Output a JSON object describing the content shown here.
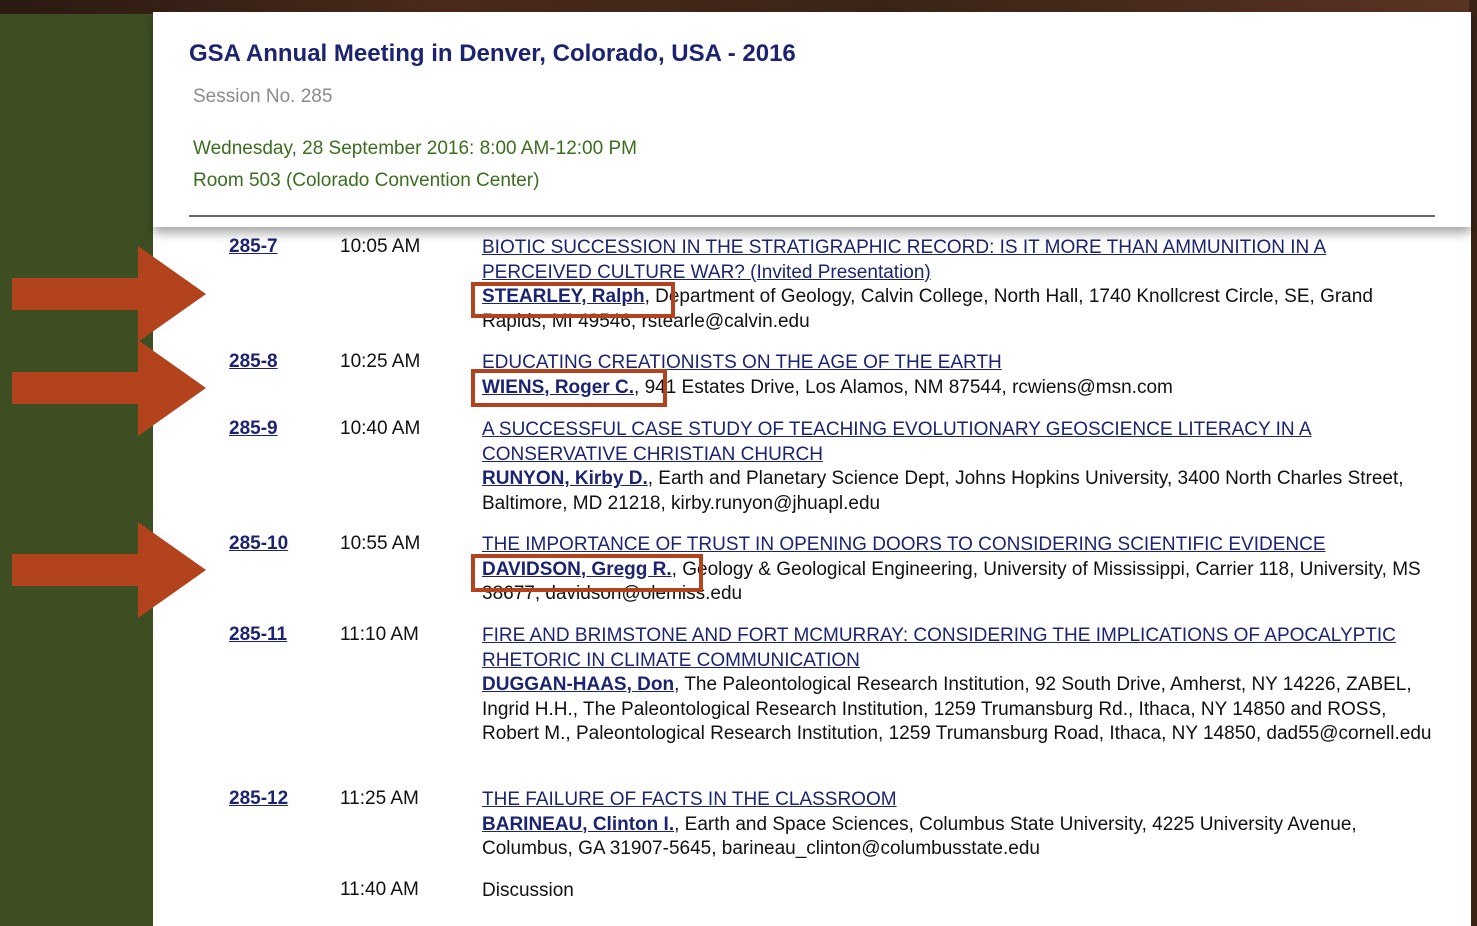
{
  "header": {
    "title": "GSA Annual Meeting in Denver, Colorado, USA - 2016",
    "session_no": "Session No. 285",
    "date_time": "Wednesday, 28 September 2016: 8:00 AM-12:00 PM",
    "room": "Room 503 (Colorado Convention Center)"
  },
  "talks": [
    {
      "code": "285-7",
      "time": "10:05 AM",
      "title": "BIOTIC SUCCESSION IN THE STRATIGRAPHIC RECORD: IS IT MORE THAN AMMUNITION IN A PERCEIVED CULTURE WAR? (Invited Presentation)",
      "author": "STEARLEY, Ralph",
      "affiliation": ", Department of Geology, Calvin College, North Hall, 1740 Knollcrest Circle, SE, Grand Rapids, MI 49546, rstearle@calvin.edu"
    },
    {
      "code": "285-8",
      "time": "10:25 AM",
      "title": "EDUCATING CREATIONISTS ON THE AGE OF THE EARTH",
      "author": "WIENS, Roger C.",
      "affiliation": ", 941 Estates Drive, Los Alamos, NM 87544, rcwiens@msn.com"
    },
    {
      "code": "285-9",
      "time": "10:40 AM",
      "title": "A SUCCESSFUL CASE STUDY OF TEACHING EVOLUTIONARY GEOSCIENCE LITERACY IN A CONSERVATIVE CHRISTIAN CHURCH",
      "author": "RUNYON, Kirby D.",
      "affiliation": ", Earth and Planetary Science Dept, Johns Hopkins University, 3400 North Charles Street, Baltimore, MD 21218, kirby.runyon@jhuapl.edu"
    },
    {
      "code": "285-10",
      "time": "10:55 AM",
      "title": "THE IMPORTANCE OF TRUST IN OPENING DOORS TO CONSIDERING SCIENTIFIC  EVIDENCE",
      "author": "DAVIDSON, Gregg R.",
      "affiliation": ", Geology & Geological Engineering, University of Mississippi, Carrier 118, University, MS 38677, davidson@olemiss.edu"
    },
    {
      "code": "285-11",
      "time": "11:10 AM",
      "title": "FIRE AND BRIMSTONE AND FORT MCMURRAY: CONSIDERING THE IMPLICATIONS OF APOCALYPTIC RHETORIC IN CLIMATE COMMUNICATION",
      "author": "DUGGAN-HAAS, Don",
      "affiliation": ", The Paleontological Research Institution, 92 South Drive, Amherst, NY 14226, ZABEL, Ingrid H.H., The Paleontological Research Institution, 1259 Trumansburg Rd., Ithaca, NY 14850 and ROSS, Robert M., Paleontological Research Institution, 1259 Trumansburg Road, Ithaca, NY 14850, dad55@cornell.edu"
    },
    {
      "code": "285-12",
      "time": "11:25 AM",
      "title": "THE FAILURE OF FACTS IN THE CLASSROOM",
      "author": "BARINEAU, Clinton I.",
      "affiliation": ", Earth and Space Sciences, Columbus State University, 4225 University Avenue, Columbus, GA 31907-5645, barineau_clinton@columbusstate.edu"
    }
  ],
  "discussion": {
    "time": "11:40 AM",
    "label": "Discussion"
  },
  "colors": {
    "background": "#3d4f22",
    "link": "#1c2472",
    "green_text": "#3a6e1e",
    "highlight": "#b2431c"
  }
}
